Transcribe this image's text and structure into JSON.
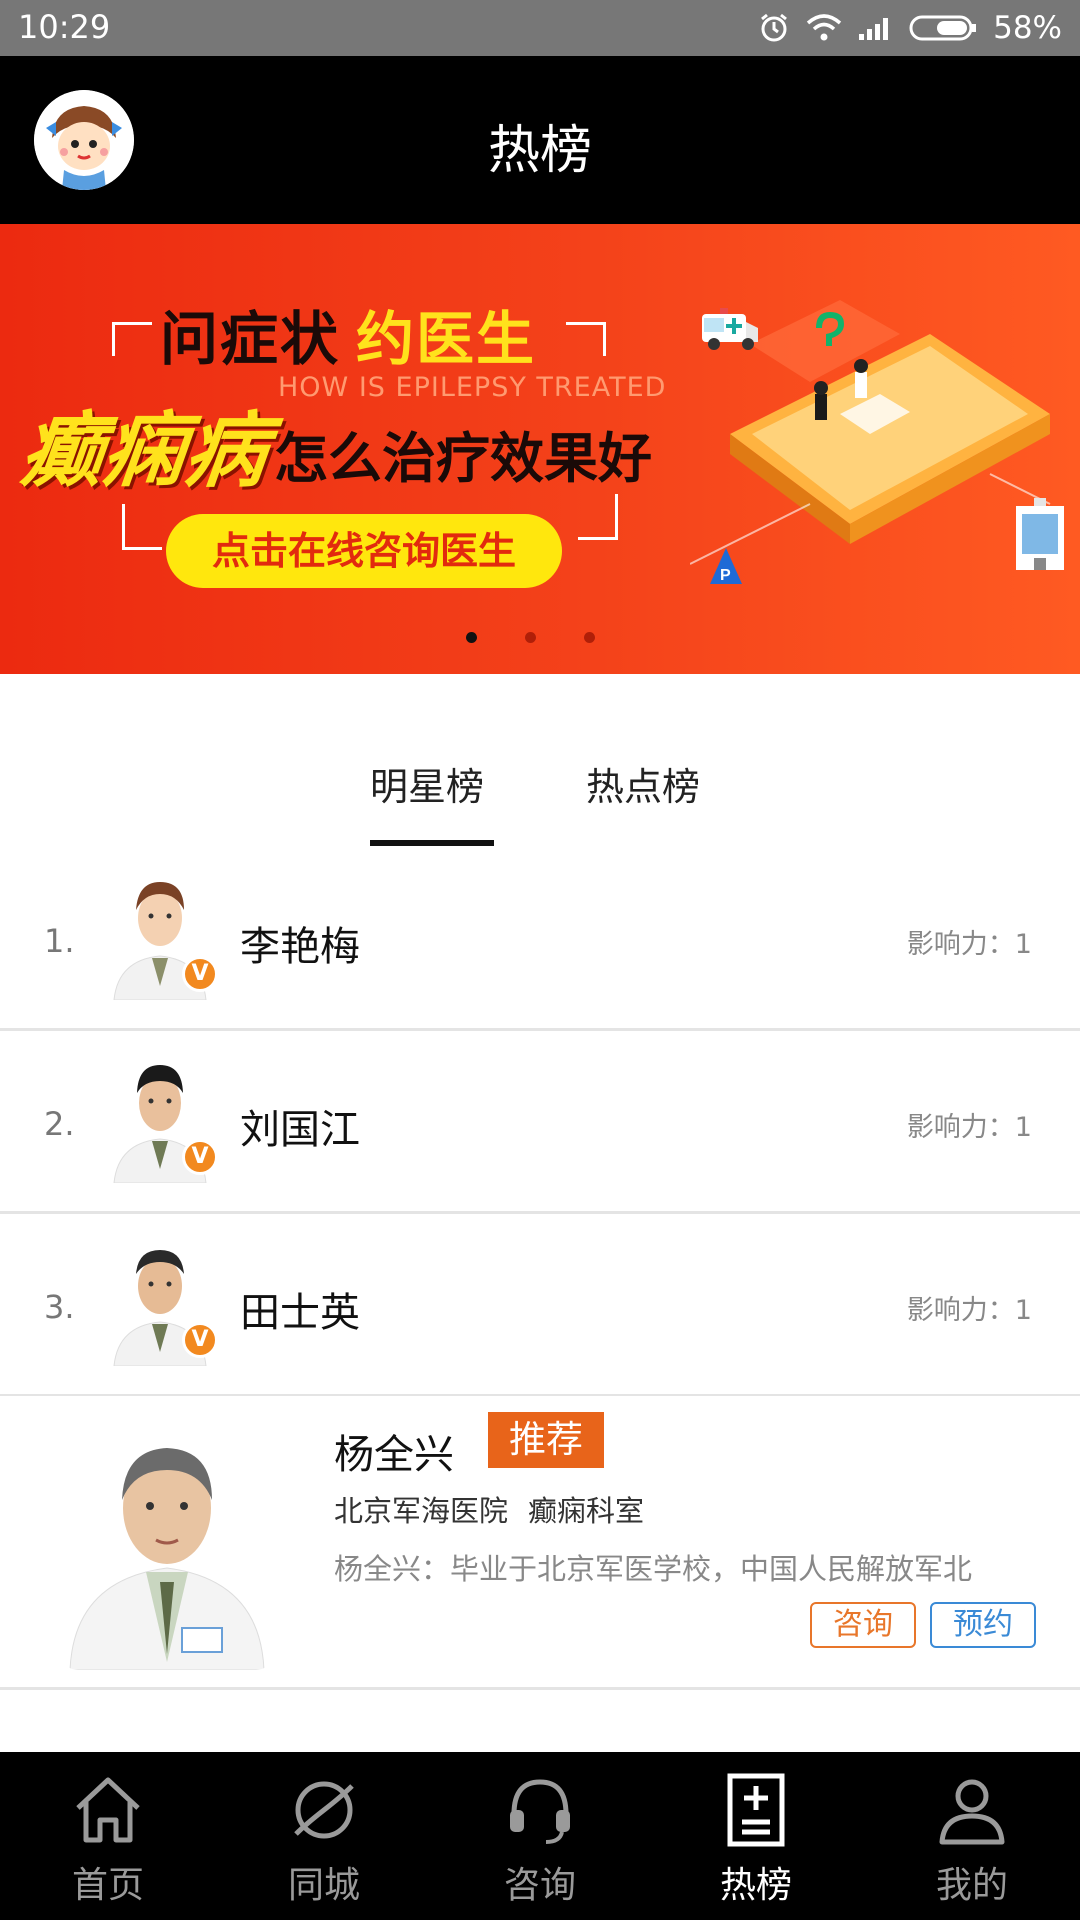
{
  "status_bar": {
    "time": "10:29",
    "battery": "58%"
  },
  "header": {
    "title": "热榜"
  },
  "banner": {
    "line1_a": "问症状",
    "line1_b": "约医生",
    "subtitle_en": "HOW IS EPILEPSY TREATED",
    "keyword": "癫痫病",
    "line2": "怎么治疗效果好",
    "cta": "点击在线咨询医生",
    "slide_count": 3,
    "active_slide": 1
  },
  "tabs": [
    {
      "label": "明星榜",
      "active": true
    },
    {
      "label": "热点榜",
      "active": false
    }
  ],
  "ranking": [
    {
      "rank": "1.",
      "name": "李艳梅",
      "influence": "影响力：1",
      "verified": "V"
    },
    {
      "rank": "2.",
      "name": "刘国江",
      "influence": "影响力：1",
      "verified": "V"
    },
    {
      "rank": "3.",
      "name": "田士英",
      "influence": "影响力：1",
      "verified": "V"
    }
  ],
  "featured": {
    "name": "杨全兴",
    "badge": "推荐",
    "hospital": "北京军海医院",
    "department": "癫痫科室",
    "description": "杨全兴：毕业于北京军医学校，中国人民解放军北",
    "consult_label": "咨询",
    "book_label": "预约"
  },
  "bottom_nav": [
    {
      "label": "首页",
      "icon": "home-icon",
      "active": false
    },
    {
      "label": "同城",
      "icon": "planet-icon",
      "active": false
    },
    {
      "label": "咨询",
      "icon": "headset-icon",
      "active": false
    },
    {
      "label": "热榜",
      "icon": "hot-list-icon",
      "active": true
    },
    {
      "label": "我的",
      "icon": "profile-icon",
      "active": false
    }
  ],
  "colors": {
    "accent_orange": "#e8641a",
    "book_blue": "#3a8ad6",
    "banner_red": "#ec2a10",
    "banner_yellow": "#ffe21c"
  }
}
